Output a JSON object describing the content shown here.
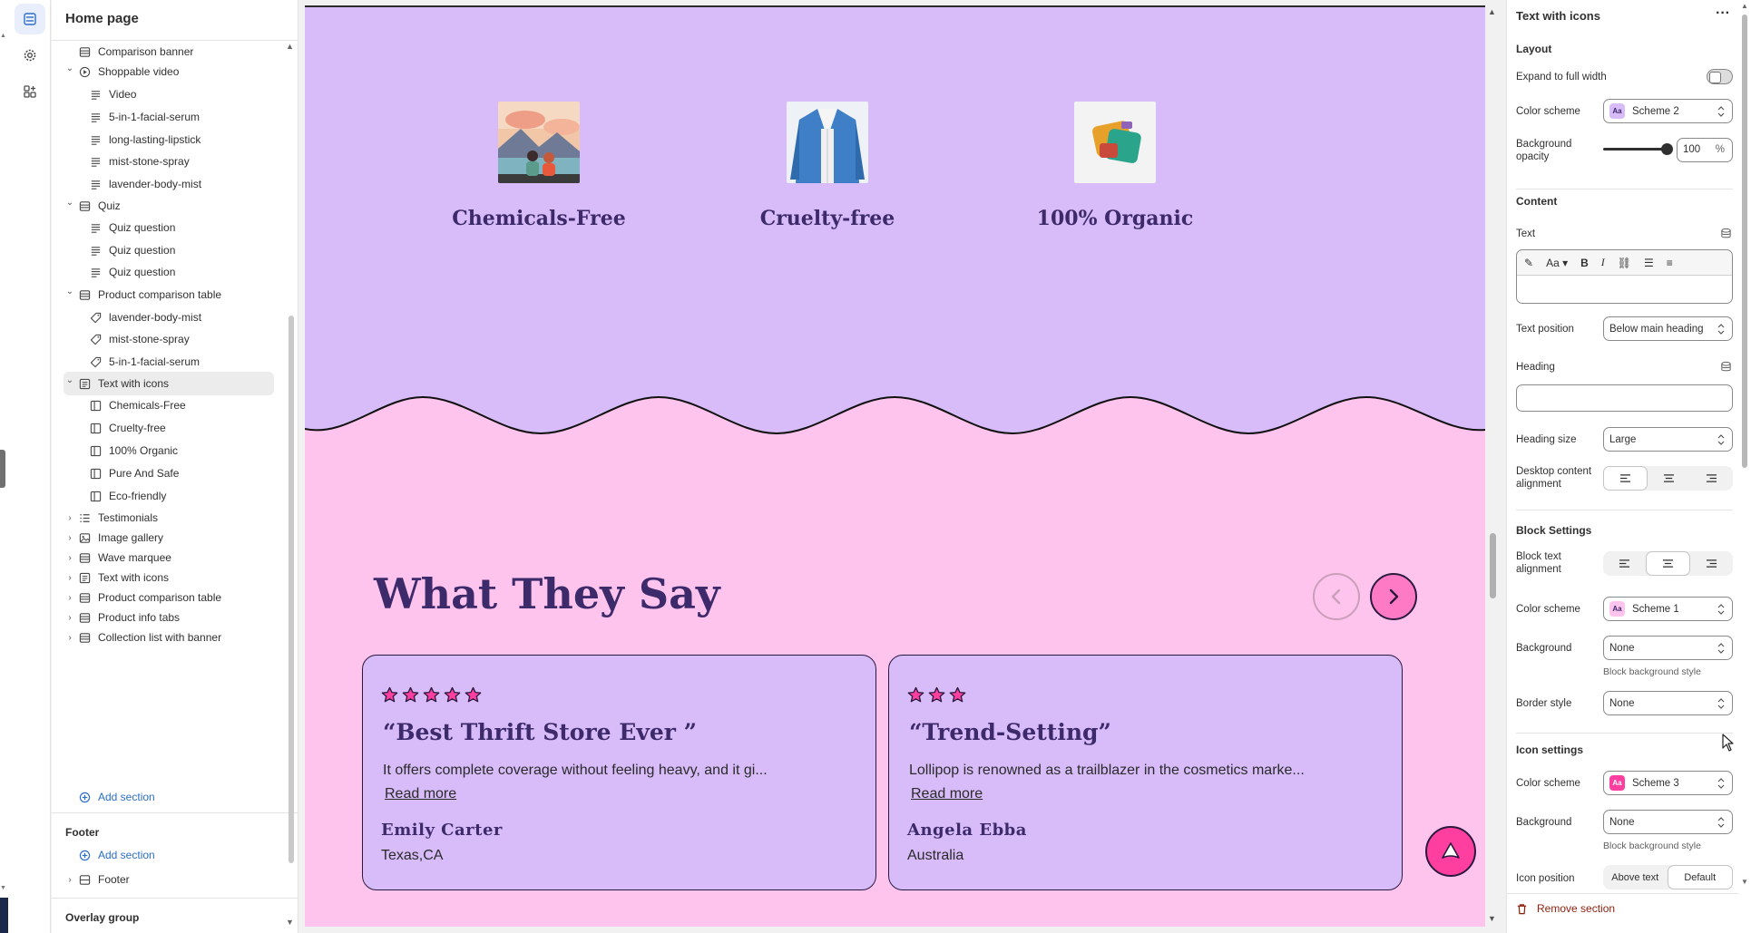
{
  "sidebar": {
    "title": "Home page",
    "rows": [
      {
        "label": "Comparison banner",
        "level": 0,
        "icon": "section-icon",
        "chevron": ""
      },
      {
        "label": "Shoppable video",
        "level": 0,
        "icon": "play-circle-icon",
        "chevron": "down"
      },
      {
        "label": "Video",
        "level": 1,
        "icon": "text-block-icon",
        "chevron": ""
      },
      {
        "label": "5-in-1-facial-serum",
        "level": 1,
        "icon": "text-block-icon",
        "chevron": ""
      },
      {
        "label": "long-lasting-lipstick",
        "level": 1,
        "icon": "text-block-icon",
        "chevron": ""
      },
      {
        "label": "mist-stone-spray",
        "level": 1,
        "icon": "text-block-icon",
        "chevron": ""
      },
      {
        "label": "lavender-body-mist",
        "level": 1,
        "icon": "text-block-icon",
        "chevron": ""
      },
      {
        "label": "Quiz",
        "level": 0,
        "icon": "section-icon",
        "chevron": "down"
      },
      {
        "label": "Quiz question",
        "level": 1,
        "icon": "text-block-icon",
        "chevron": ""
      },
      {
        "label": "Quiz question",
        "level": 1,
        "icon": "text-block-icon",
        "chevron": ""
      },
      {
        "label": "Quiz question",
        "level": 1,
        "icon": "text-block-icon",
        "chevron": ""
      },
      {
        "label": "Product comparison table",
        "level": 0,
        "icon": "section-icon",
        "chevron": "down"
      },
      {
        "label": "lavender-body-mist",
        "level": 1,
        "icon": "tag-icon",
        "chevron": ""
      },
      {
        "label": "mist-stone-spray",
        "level": 1,
        "icon": "tag-icon",
        "chevron": ""
      },
      {
        "label": "5-in-1-facial-serum",
        "level": 1,
        "icon": "tag-icon",
        "chevron": ""
      },
      {
        "label": "Text with icons",
        "level": 0,
        "icon": "text-section-icon",
        "chevron": "down",
        "selected": true
      },
      {
        "label": "Chemicals-Free",
        "level": 1,
        "icon": "column-icon",
        "chevron": ""
      },
      {
        "label": "Cruelty-free",
        "level": 1,
        "icon": "column-icon",
        "chevron": ""
      },
      {
        "label": "100% Organic",
        "level": 1,
        "icon": "column-icon",
        "chevron": ""
      },
      {
        "label": "Pure And Safe",
        "level": 1,
        "icon": "column-icon",
        "chevron": ""
      },
      {
        "label": "Eco-friendly",
        "level": 1,
        "icon": "column-icon",
        "chevron": ""
      },
      {
        "label": "Testimonials",
        "level": 0,
        "icon": "list-icon",
        "chevron": "right"
      },
      {
        "label": "Image gallery",
        "level": 0,
        "icon": "image-icon",
        "chevron": "right"
      },
      {
        "label": "Wave marquee",
        "level": 0,
        "icon": "section-icon",
        "chevron": "right"
      },
      {
        "label": "Text with icons",
        "level": 0,
        "icon": "text-section-icon",
        "chevron": "right"
      },
      {
        "label": "Product comparison table",
        "level": 0,
        "icon": "section-icon",
        "chevron": "right"
      },
      {
        "label": "Product info tabs",
        "level": 0,
        "icon": "section-icon",
        "chevron": "right"
      },
      {
        "label": "Collection list with banner",
        "level": 0,
        "icon": "section-icon",
        "chevron": "right"
      }
    ],
    "add_section": "Add section",
    "footer_heading": "Footer",
    "footer_add": "Add section",
    "footer_item": "Footer",
    "overlay_heading": "Overlay group"
  },
  "canvas": {
    "features": [
      {
        "title": "Chemicals-Free"
      },
      {
        "title": "Cruelty-free"
      },
      {
        "title": "100% Organic"
      }
    ],
    "testimonials_heading": "What They Say",
    "cards": [
      {
        "stars": 5,
        "quote": "“Best Thrift Store Ever ”",
        "body": "It offers complete coverage without feeling heavy, and it gi...",
        "read_more": "Read more",
        "name": "Emily Carter",
        "location": "Texas,CA"
      },
      {
        "stars": 3,
        "quote": "“Trend-Setting”",
        "body": "Lollipop is renowned as a trailblazer in the cosmetics marke...",
        "read_more": "Read more",
        "name": "Angela  Ebba",
        "location": "Australia"
      }
    ],
    "colors": {
      "purple_bg": "#d8bcf9",
      "pink_bg": "#ffc4ed",
      "heading": "#3d2a6b",
      "accent": "#ff3fa0"
    }
  },
  "panel": {
    "title": "Text with icons",
    "layout_heading": "Layout",
    "expand_label": "Expand to full width",
    "color_scheme_label": "Color scheme",
    "color_scheme_value": "Scheme 2",
    "bg_opacity_label": "Background opacity",
    "bg_opacity_value": "100",
    "bg_opacity_unit": "%",
    "content_heading": "Content",
    "text_label": "Text",
    "text_position_label": "Text position",
    "text_position_value": "Below main heading",
    "heading_label": "Heading",
    "heading_size_label": "Heading size",
    "heading_size_value": "Large",
    "desktop_alignment_label": "Desktop content alignment",
    "block_settings_heading": "Block Settings",
    "block_text_alignment_label": "Block text alignment",
    "block_color_scheme_label": "Color scheme",
    "block_color_scheme_value": "Scheme 1",
    "block_background_label": "Background",
    "block_background_value": "None",
    "block_background_hint": "Block background style",
    "border_style_label": "Border style",
    "border_style_value": "None",
    "icon_settings_heading": "Icon settings",
    "icon_color_scheme_label": "Color scheme",
    "icon_color_scheme_value": "Scheme 3",
    "icon_background_label": "Background",
    "icon_background_value": "None",
    "icon_background_hint": "Block background style",
    "icon_position_label": "Icon position",
    "icon_position_options": [
      "Above text",
      "Default"
    ],
    "remove_section": "Remove section",
    "rte_font_label": "Aa",
    "swatch_label": "Aa"
  }
}
